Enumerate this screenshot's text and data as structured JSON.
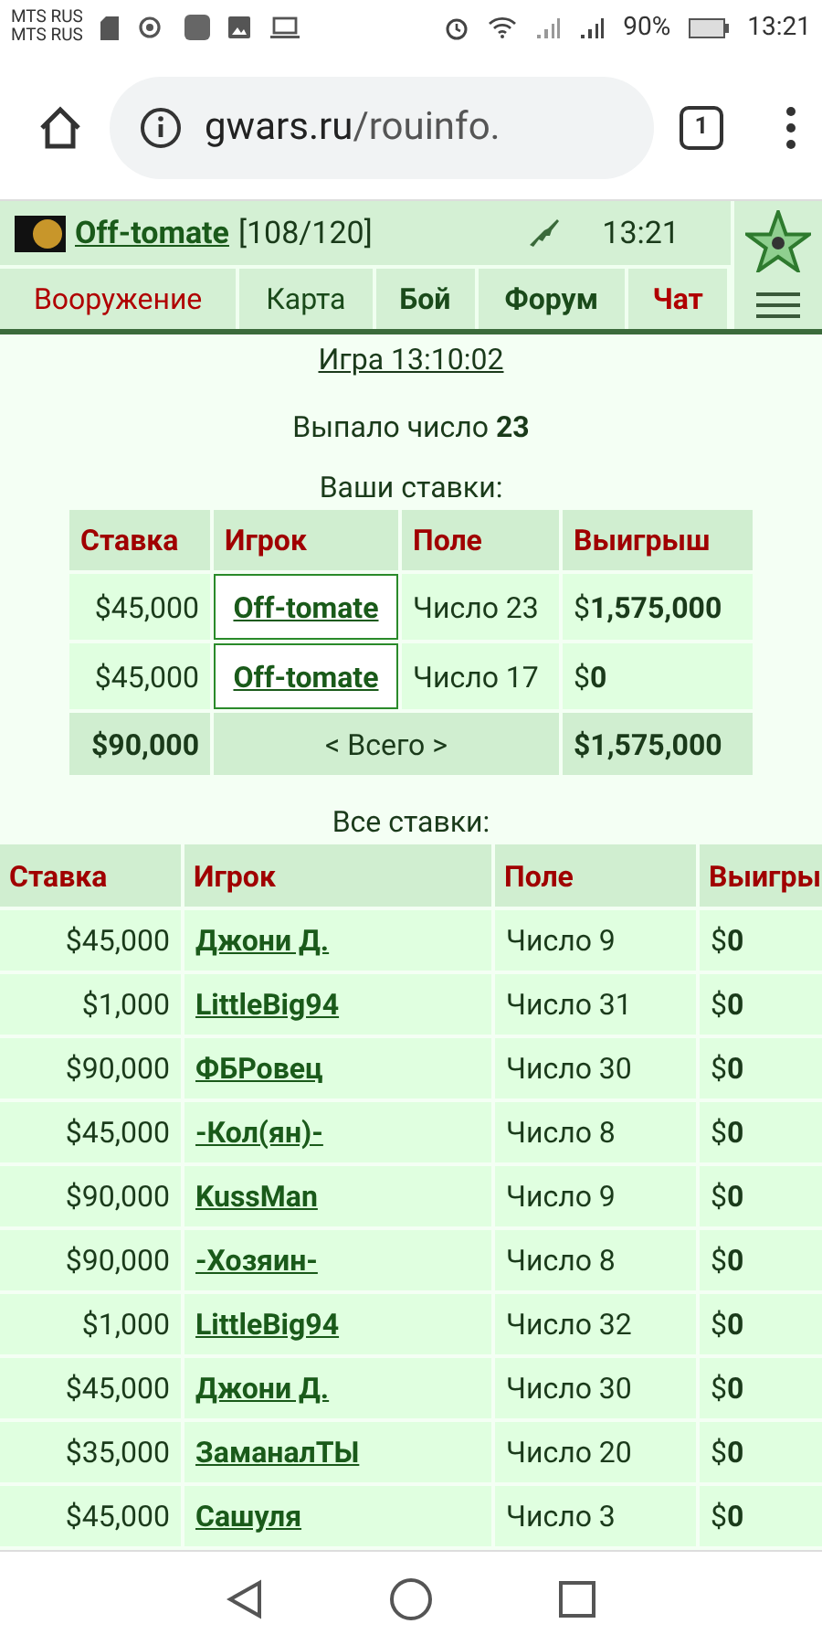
{
  "status_bar": {
    "carriers": [
      "MTS RUS",
      "MTS RUS"
    ],
    "battery": "90%",
    "time": "13:21"
  },
  "browser": {
    "host": "gwars.ru",
    "path": "/rouinfo.",
    "tab_count": "1"
  },
  "header": {
    "player": "Off-tomate",
    "hp": "[108/120]",
    "time": "13:21"
  },
  "nav": [
    {
      "label": "Вооружение",
      "color": "#b00000",
      "bold": false
    },
    {
      "label": "Карта",
      "color": "#1a4a1a",
      "bold": false
    },
    {
      "label": "Бой",
      "color": "#1a4a1a",
      "bold": true
    },
    {
      "label": "Форум",
      "color": "#1a4a1a",
      "bold": true
    },
    {
      "label": "Чат",
      "color": "#b00000",
      "bold": true
    }
  ],
  "game_link": "Игра 13:10:02",
  "result": "Выпало число **23**",
  "your_bets": {
    "title": "Ваши ставки:",
    "columns": [
      "Ставка",
      "Игрок",
      "Поле",
      "Выигрыш"
    ],
    "rows": [
      {
        "stake": "$45,000",
        "player": "Off-tomate",
        "field": "Число 23",
        "win": "$**1,575,000**"
      },
      {
        "stake": "$45,000",
        "player": "Off-tomate",
        "field": "Число 17",
        "win": "$**0**"
      }
    ],
    "total": {
      "stake": "$90,000",
      "label": "< Всего >",
      "win": "$1,575,000"
    }
  },
  "all_bets": {
    "title": "Все ставки:",
    "columns": [
      "Ставка",
      "Игрок",
      "Поле",
      "Выигры"
    ],
    "rows": [
      {
        "stake": "$45,000",
        "player": "Джони Д.",
        "field": "Число 9",
        "win": "$**0**"
      },
      {
        "stake": "$1,000",
        "player": "LittleBig94",
        "field": "Число 31",
        "win": "$**0**"
      },
      {
        "stake": "$90,000",
        "player": "ФБРовец",
        "field": "Число 30",
        "win": "$**0**"
      },
      {
        "stake": "$45,000",
        "player": "-Кол(ян)-",
        "field": "Число 8",
        "win": "$**0**"
      },
      {
        "stake": "$90,000",
        "player": "KussMan",
        "field": "Число 9",
        "win": "$**0**"
      },
      {
        "stake": "$90,000",
        "player": "-Хозяин-",
        "field": "Число 8",
        "win": "$**0**"
      },
      {
        "stake": "$1,000",
        "player": "LittleBig94",
        "field": "Число 32",
        "win": "$**0**"
      },
      {
        "stake": "$45,000",
        "player": "Джони Д.",
        "field": "Число 30",
        "win": "$**0**"
      },
      {
        "stake": "$35,000",
        "player": "ЗаманалТЫ",
        "field": "Число 20",
        "win": "$**0**"
      },
      {
        "stake": "$45,000",
        "player": "Сашуля",
        "field": "Число 3",
        "win": "$**0**"
      }
    ]
  }
}
